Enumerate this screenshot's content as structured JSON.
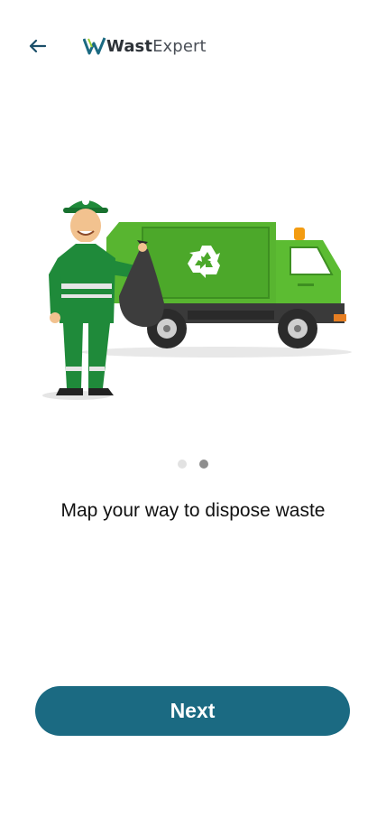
{
  "header": {
    "logo_prefix": "Wast",
    "logo_suffix": "Expert",
    "back_icon": "arrow-left-icon"
  },
  "onboarding": {
    "caption": "Map your way to dispose waste",
    "page_indicator": {
      "total": 2,
      "active_index": 1
    }
  },
  "actions": {
    "next_label": "Next"
  },
  "colors": {
    "primary": "#1b6a82",
    "truck_green": "#4caf2a",
    "worker_green": "#1f8a3a",
    "dot_inactive": "#e2e2e2",
    "dot_active": "#8e8e8e"
  }
}
